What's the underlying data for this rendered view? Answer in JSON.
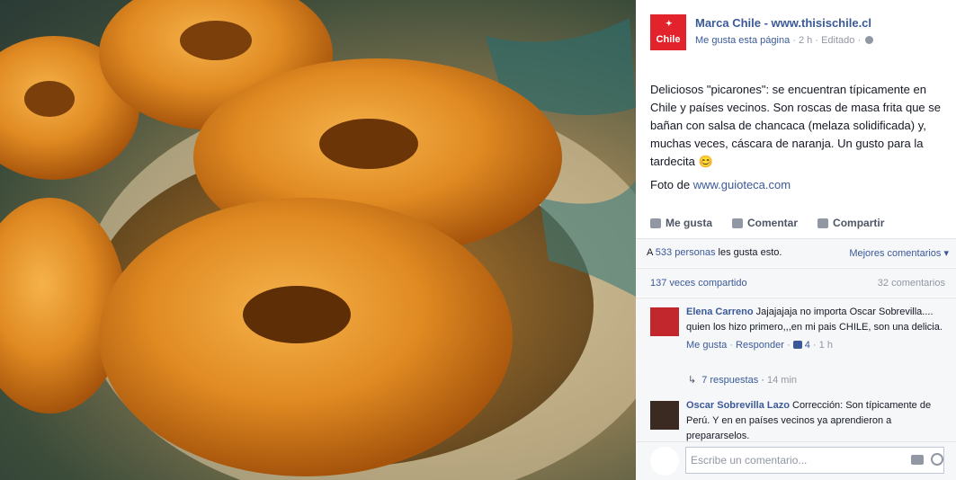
{
  "photo": {
    "alt": "picarones"
  },
  "post": {
    "page_name": "Marca Chile - www.thisischile.cl",
    "logo_text": "Chile",
    "like_page": "Me gusta esta página",
    "time": "2 h",
    "edited": "Editado",
    "text": "Deliciosos \"picarones\": se encuentran típicamente en Chile y países vecinos. Son roscas de masa frita que se bañan con salsa de chancaca (melaza solidificada) y, muchas veces, cáscara de naranja. Un gusto para la tardecita 😊",
    "credit_prefix": "Foto de ",
    "credit_link": "www.guioteca.com"
  },
  "actions": {
    "like": "Me gusta",
    "comment": "Comentar",
    "share": "Compartir"
  },
  "stats": {
    "likes_prefix": "A ",
    "likes_link": "533 personas",
    "likes_suffix": " les gusta esto.",
    "sort": "Mejores comentarios ▾",
    "shares": "137 veces compartido",
    "comments_count": "32 comentarios"
  },
  "comments": [
    {
      "author": "Elena Carreno",
      "text": " Jajajajaja no importa Oscar Sobrevilla.... quien los hizo primero,,,en mi pais CHILE, son una delicia.",
      "like": "Me gusta",
      "reply": "Responder",
      "likes": "4",
      "time": "1 h",
      "replies": "7 respuestas",
      "replies_time": "14 min"
    },
    {
      "author": "Oscar Sobrevilla Lazo",
      "text": " Corrección: Son típicamente de Perú. Y en en países vecinos ya aprendieron a prepararselos."
    }
  ],
  "composer": {
    "placeholder": "Escribe un comentario..."
  }
}
